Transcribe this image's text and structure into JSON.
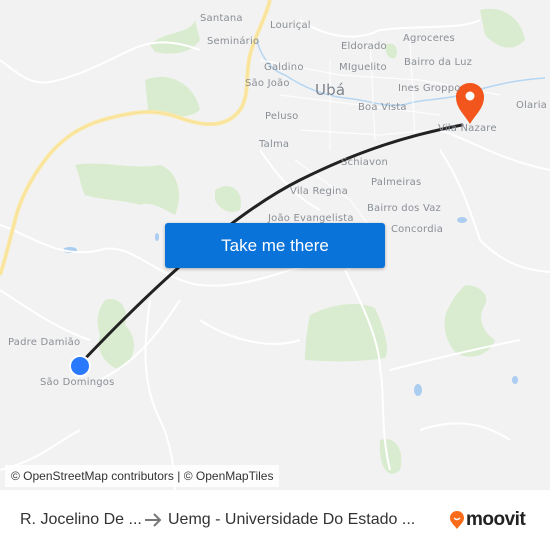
{
  "map": {
    "places": [
      {
        "name": "Santana",
        "kind": "suburb"
      },
      {
        "name": "Louriçal",
        "kind": "suburb"
      },
      {
        "name": "Seminário",
        "kind": "suburb"
      },
      {
        "name": "Agroceres",
        "kind": "suburb"
      },
      {
        "name": "Eldorado",
        "kind": "suburb"
      },
      {
        "name": "Bairro da Luz",
        "kind": "suburb"
      },
      {
        "name": "Galdino",
        "kind": "suburb"
      },
      {
        "name": "MIguelito",
        "kind": "suburb"
      },
      {
        "name": "São João",
        "kind": "suburb"
      },
      {
        "name": "Ubá",
        "kind": "city"
      },
      {
        "name": "Ines Groppo",
        "kind": "suburb"
      },
      {
        "name": "Olaria",
        "kind": "suburb"
      },
      {
        "name": "Boa Vista",
        "kind": "suburb"
      },
      {
        "name": "Peluso",
        "kind": "suburb"
      },
      {
        "name": "Vila Nazare",
        "kind": "suburb"
      },
      {
        "name": "Talma",
        "kind": "suburb"
      },
      {
        "name": "Schiavon",
        "kind": "suburb"
      },
      {
        "name": "Palmeiras",
        "kind": "suburb"
      },
      {
        "name": "Vila Regina",
        "kind": "suburb"
      },
      {
        "name": "Bairro dos Vaz",
        "kind": "suburb"
      },
      {
        "name": "João Evangelista",
        "kind": "suburb"
      },
      {
        "name": "Concordia",
        "kind": "suburb"
      },
      {
        "name": "Padre Damião",
        "kind": "suburb"
      },
      {
        "name": "São Domingos",
        "kind": "suburb"
      }
    ],
    "origin_marker": {
      "icon": "origin-dot-icon",
      "color": "#2979ff"
    },
    "destination_marker": {
      "icon": "map-pin-icon",
      "color": "#f2561d"
    },
    "route_color": "#222222",
    "cta_label": "Take me there",
    "cta_color": "#0a73d9",
    "attribution": "© OpenStreetMap contributors | © OpenMapTiles"
  },
  "footer": {
    "from": "R. Jocelino De ...",
    "arrow_icon": "arrow-right-icon",
    "to": "Uemg - Universidade Do Estado ...",
    "brand": "moovit",
    "brand_color": "#f96b18"
  }
}
